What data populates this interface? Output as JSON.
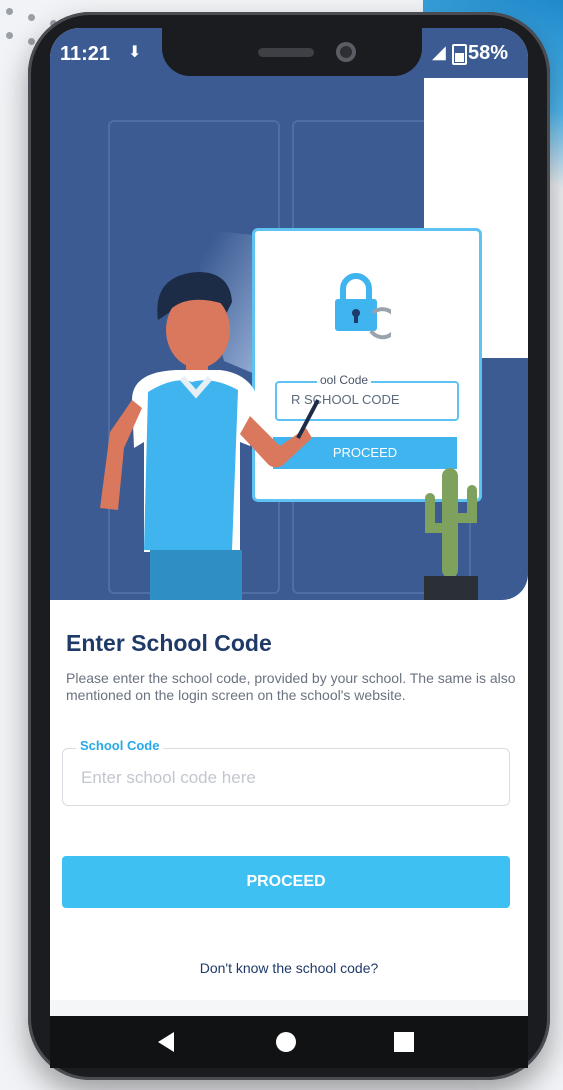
{
  "status_bar": {
    "time": "11:21",
    "battery": "58%",
    "download_icon": "download-arrow-icon",
    "signal_icon": "signal-icon"
  },
  "illustration": {
    "card_field_label": "ool Code",
    "card_field_text": "R SCHOOL CODE",
    "card_button": "PROCEED",
    "accent_color": "#3fb4ef",
    "hero_bg_color": "#3b5b92"
  },
  "form": {
    "title": "Enter School Code",
    "description": "Please enter the school code, provided by your school. The same is also mentioned on the login screen on the school's website.",
    "field_label": "School Code",
    "field_placeholder": "Enter school code here",
    "field_value": "",
    "proceed_label": "PROCEED",
    "help_link": "Don't know the school code?"
  },
  "nav": {
    "back_icon": "back-triangle-icon",
    "home_icon": "home-circle-icon",
    "recents_icon": "recents-square-icon"
  }
}
